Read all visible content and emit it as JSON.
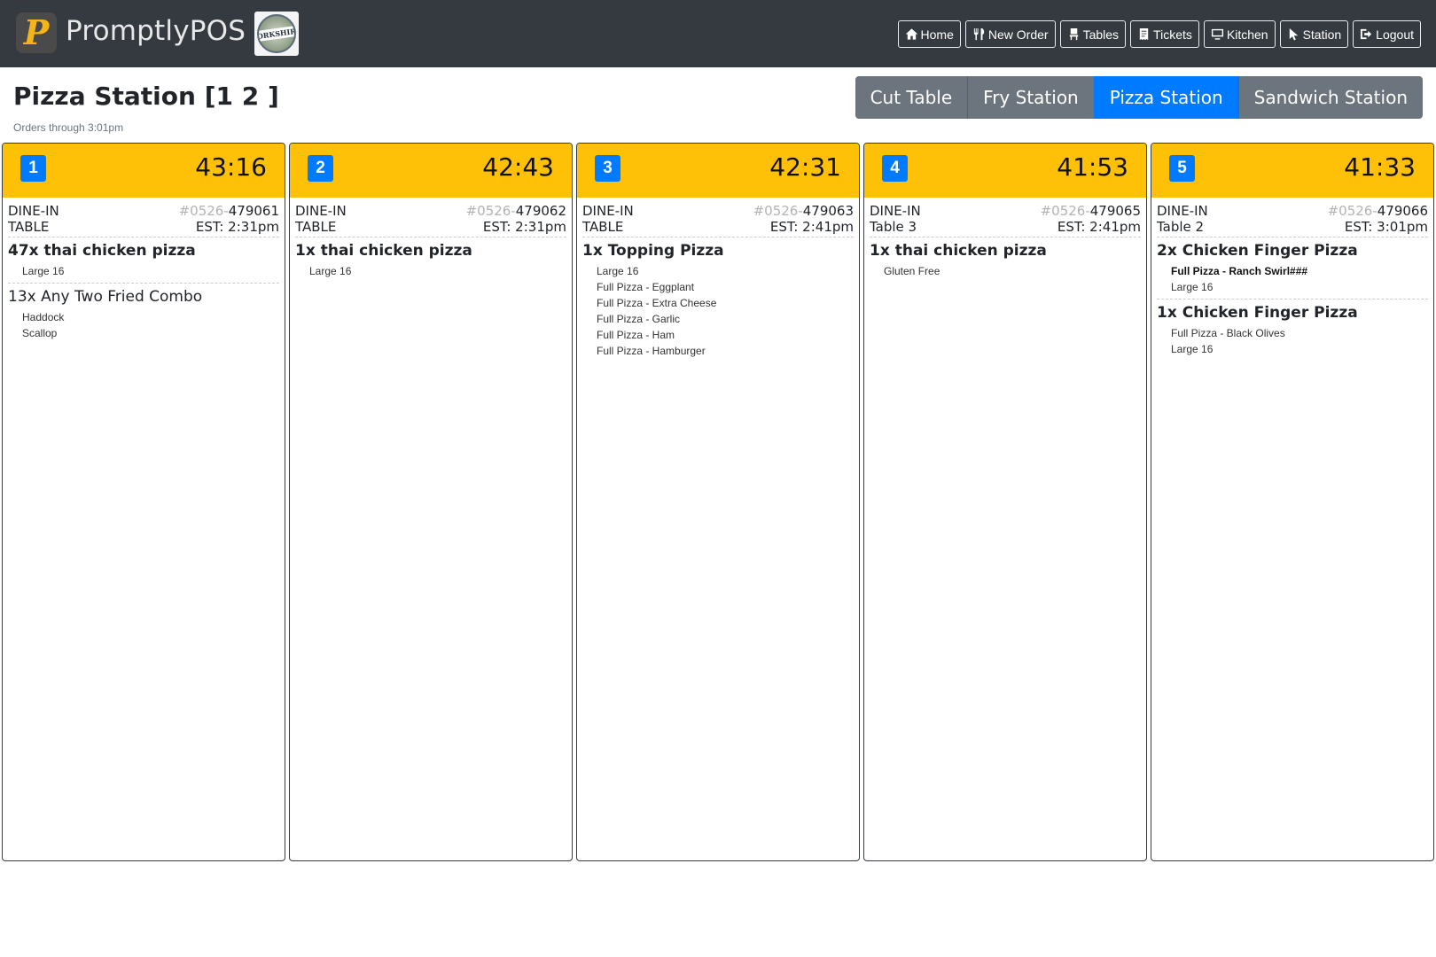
{
  "navbar": {
    "brand": "PromptlyPOS",
    "logo_letter": "P",
    "partner_logo_text": "YORKSHIRE",
    "buttons": [
      {
        "label": "Home",
        "icon": "home-icon"
      },
      {
        "label": "New Order",
        "icon": "utensils-icon"
      },
      {
        "label": "Tables",
        "icon": "chair-icon"
      },
      {
        "label": "Tickets",
        "icon": "receipt-icon"
      },
      {
        "label": "Kitchen",
        "icon": "monitor-icon"
      },
      {
        "label": "Station",
        "icon": "cursor-icon"
      },
      {
        "label": "Logout",
        "icon": "logout-icon"
      }
    ]
  },
  "header": {
    "title": "Pizza Station [1 2 ]",
    "subtitle": "Orders through 3:01pm"
  },
  "station_tabs": [
    {
      "label": "Cut Table",
      "active": false
    },
    {
      "label": "Fry Station",
      "active": false
    },
    {
      "label": "Pizza Station",
      "active": true
    },
    {
      "label": "Sandwich Station",
      "active": false
    }
  ],
  "colors": {
    "navbar": "#343a40",
    "ticket_header": "#ffc107",
    "accent": "#007bff",
    "inactive_tab": "#6c757d"
  },
  "tickets": [
    {
      "number": "1",
      "timer": "43:16",
      "type": "DINE-IN",
      "table": "TABLE",
      "order_prefix": "#0526-",
      "order_id": "479061",
      "est": "EST: 2:31pm",
      "items": [
        {
          "title": "47x thai chicken pizza",
          "bold": true,
          "mods": [
            {
              "text": "Large 16",
              "bold": false
            }
          ]
        },
        {
          "title": "13x Any Two Fried Combo",
          "bold": false,
          "mods": [
            {
              "text": "Haddock",
              "bold": false
            },
            {
              "text": "Scallop",
              "bold": false
            }
          ]
        }
      ]
    },
    {
      "number": "2",
      "timer": "42:43",
      "type": "DINE-IN",
      "table": "TABLE",
      "order_prefix": "#0526-",
      "order_id": "479062",
      "est": "EST: 2:31pm",
      "items": [
        {
          "title": "1x thai chicken pizza",
          "bold": true,
          "mods": [
            {
              "text": "Large 16",
              "bold": false
            }
          ]
        }
      ]
    },
    {
      "number": "3",
      "timer": "42:31",
      "type": "DINE-IN",
      "table": "TABLE",
      "order_prefix": "#0526-",
      "order_id": "479063",
      "est": "EST: 2:41pm",
      "items": [
        {
          "title": "1x Topping Pizza",
          "bold": true,
          "mods": [
            {
              "text": "Large 16",
              "bold": false
            },
            {
              "text": "Full Pizza - Eggplant",
              "bold": false
            },
            {
              "text": "Full Pizza - Extra Cheese",
              "bold": false
            },
            {
              "text": "Full Pizza - Garlic",
              "bold": false
            },
            {
              "text": "Full Pizza - Ham",
              "bold": false
            },
            {
              "text": "Full Pizza - Hamburger",
              "bold": false
            }
          ]
        }
      ]
    },
    {
      "number": "4",
      "timer": "41:53",
      "type": "DINE-IN",
      "table": "Table 3",
      "order_prefix": "#0526-",
      "order_id": "479065",
      "est": "EST: 2:41pm",
      "items": [
        {
          "title": "1x thai chicken pizza",
          "bold": true,
          "mods": [
            {
              "text": "Gluten Free",
              "bold": false
            }
          ]
        }
      ]
    },
    {
      "number": "5",
      "timer": "41:33",
      "type": "DINE-IN",
      "table": "Table 2",
      "order_prefix": "#0526-",
      "order_id": "479066",
      "est": "EST: 3:01pm",
      "items": [
        {
          "title": "2x Chicken Finger Pizza",
          "bold": true,
          "mods": [
            {
              "text": "Full Pizza - Ranch Swirl###",
              "bold": true
            },
            {
              "text": "Large 16",
              "bold": false
            }
          ]
        },
        {
          "title": "1x Chicken Finger Pizza",
          "bold": true,
          "mods": [
            {
              "text": "Full Pizza - Black Olives",
              "bold": false
            },
            {
              "text": "Large 16",
              "bold": false
            }
          ]
        }
      ]
    }
  ]
}
